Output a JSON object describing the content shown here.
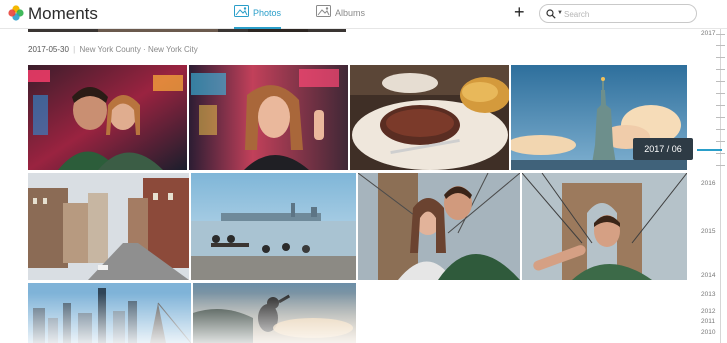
{
  "app": {
    "title": "Moments"
  },
  "tabs": [
    {
      "label": "Photos",
      "icon": "photos-icon",
      "active": true
    },
    {
      "label": "Albums",
      "icon": "albums-icon",
      "active": false
    }
  ],
  "toolbar": {
    "add_label": "+"
  },
  "search": {
    "placeholder": "Search",
    "value": ""
  },
  "section": {
    "date": "2017-05-30",
    "separator": "|",
    "location": "New York County · New York City"
  },
  "tooltip": {
    "text": "2017 / 06"
  },
  "scrubber": {
    "years": [
      "2017",
      "2016",
      "2015",
      "2014",
      "2013",
      "2012",
      "2011",
      "2010"
    ]
  },
  "colors": {
    "accent": "#2a9ec9",
    "tooltip_bg": "#2e3b45"
  },
  "photos": [
    {
      "subject": "couple selfie neon Times Square"
    },
    {
      "subject": "woman selfie neon lights"
    },
    {
      "subject": "steak dinner with fries"
    },
    {
      "subject": "Statue of Liberty sky"
    },
    {
      "subject": "city street buildings"
    },
    {
      "subject": "people at waterfront skyline"
    },
    {
      "subject": "couple selfie Brooklyn Bridge"
    },
    {
      "subject": "man selfie Brooklyn Bridge"
    },
    {
      "subject": "Manhattan skyline"
    },
    {
      "subject": "hiker at sunset"
    }
  ]
}
